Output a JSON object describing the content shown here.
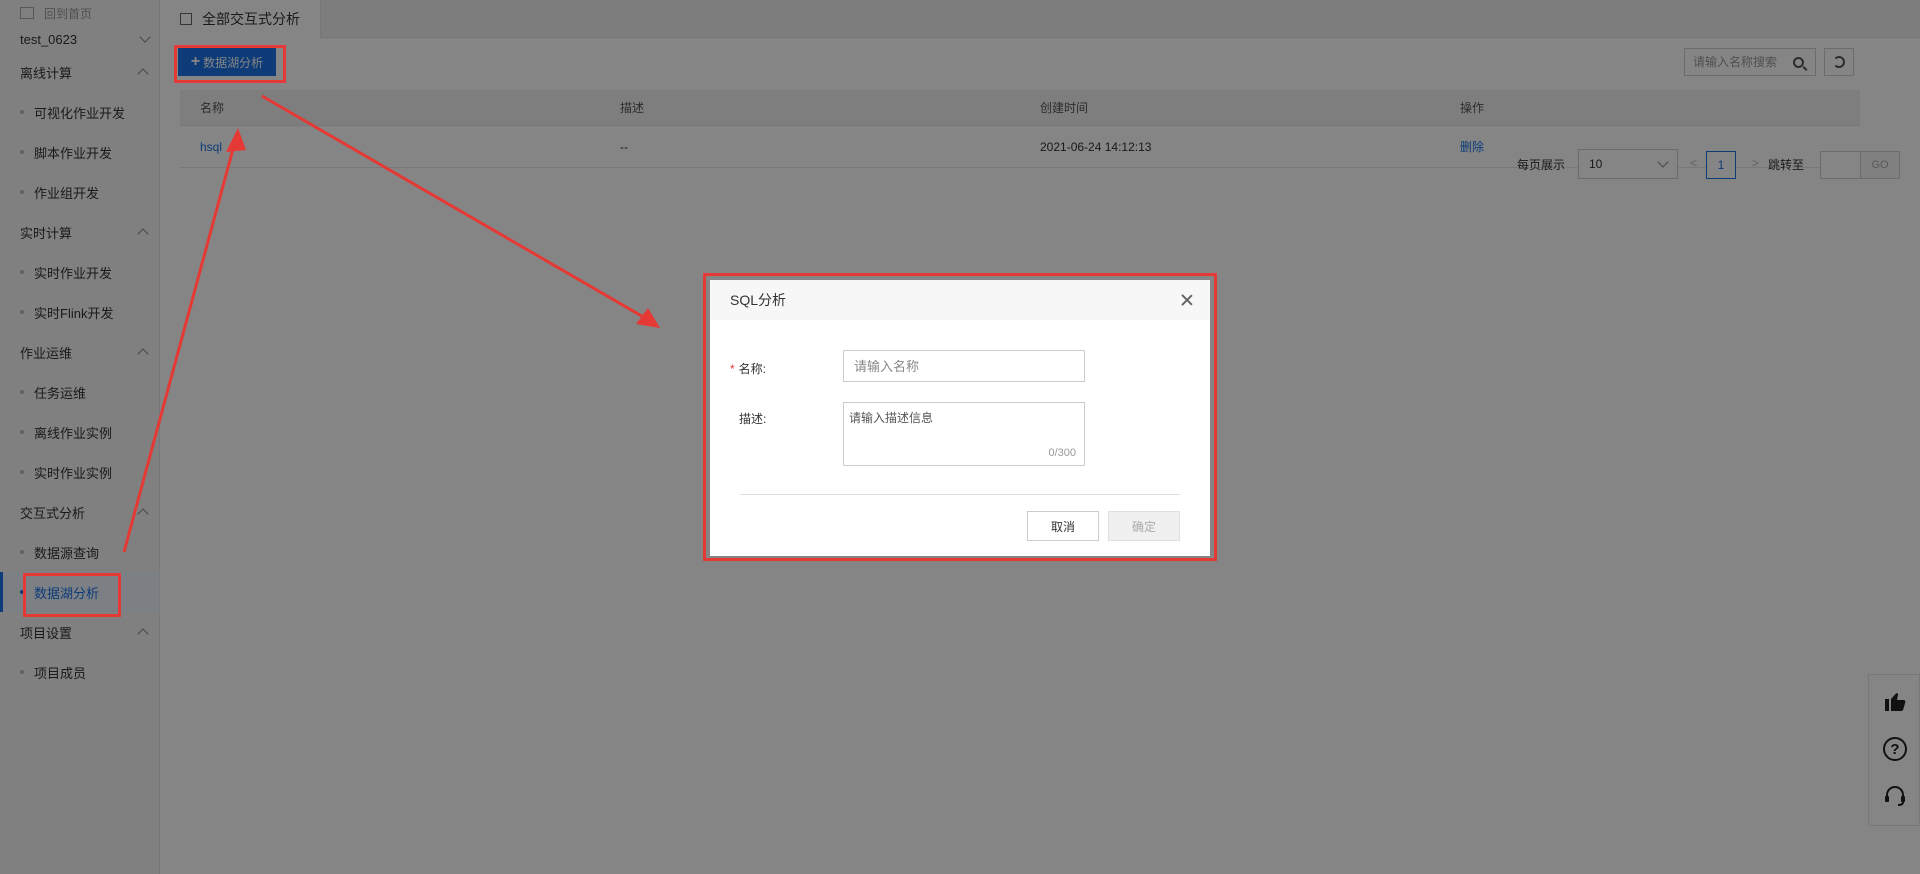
{
  "sidebar": {
    "back_label": "回到首页",
    "project": "test_0623",
    "groups": [
      {
        "label": "离线计算",
        "items": [
          "可视化作业开发",
          "脚本作业开发",
          "作业组开发"
        ]
      },
      {
        "label": "实时计算",
        "items": [
          "实时作业开发",
          "实时Flink开发"
        ]
      },
      {
        "label": "作业运维",
        "items": [
          "任务运维",
          "离线作业实例",
          "实时作业实例"
        ]
      },
      {
        "label": "交互式分析",
        "items": [
          "数据源查询",
          "数据湖分析"
        ]
      },
      {
        "label": "项目设置",
        "items": [
          "项目成员"
        ]
      }
    ],
    "active_item": "数据湖分析"
  },
  "header": {
    "tab_label": "全部交互式分析"
  },
  "toolbar": {
    "add_label": "数据湖分析",
    "search_placeholder": "请输入名称搜索"
  },
  "table": {
    "columns": [
      "名称",
      "描述",
      "创建时间",
      "操作"
    ],
    "rows": [
      {
        "name": "hsql",
        "desc": "--",
        "created": "2021-06-24 14:12:13",
        "action": "删除"
      }
    ]
  },
  "pagination": {
    "per_page_label": "每页展示",
    "per_page_value": "10",
    "prev": "<",
    "current_page": "1",
    "next": ">",
    "jump_label": "跳转至",
    "go_label": "GO"
  },
  "modal": {
    "title": "SQL分析",
    "name_label": "名称:",
    "name_required_mark": "*",
    "name_placeholder": "请输入名称",
    "desc_label": "描述:",
    "desc_placeholder": "请输入描述信息",
    "desc_count": "0/300",
    "cancel_label": "取消",
    "ok_label": "确定"
  },
  "colors": {
    "primary": "#1a73e8",
    "highlight": "#e53935"
  }
}
